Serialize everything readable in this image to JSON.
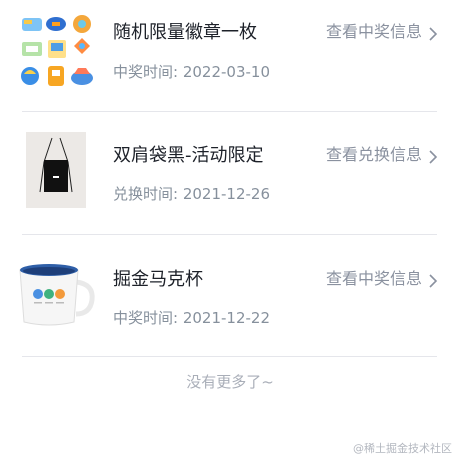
{
  "items": [
    {
      "title": "随机限量徽章一枚",
      "date_label": "中奖时间: ",
      "date": "2022-03-10",
      "action": "查看中奖信息",
      "thumb_icon": "badges-icon"
    },
    {
      "title": "双肩袋黑-活动限定",
      "date_label": "兑换时间: ",
      "date": "2021-12-26",
      "action": "查看兑换信息",
      "thumb_icon": "drawstring-bag-icon"
    },
    {
      "title": "掘金马克杯",
      "date_label": "中奖时间: ",
      "date": "2021-12-22",
      "action": "查看中奖信息",
      "thumb_icon": "mug-icon"
    }
  ],
  "footer_text": "没有更多了~",
  "watermark": "@稀土掘金技术社区",
  "colors": {
    "title": "#1d2129",
    "secondary": "#86909c",
    "divider": "#e5e6eb",
    "mug_blue": "#2f5fa8"
  }
}
